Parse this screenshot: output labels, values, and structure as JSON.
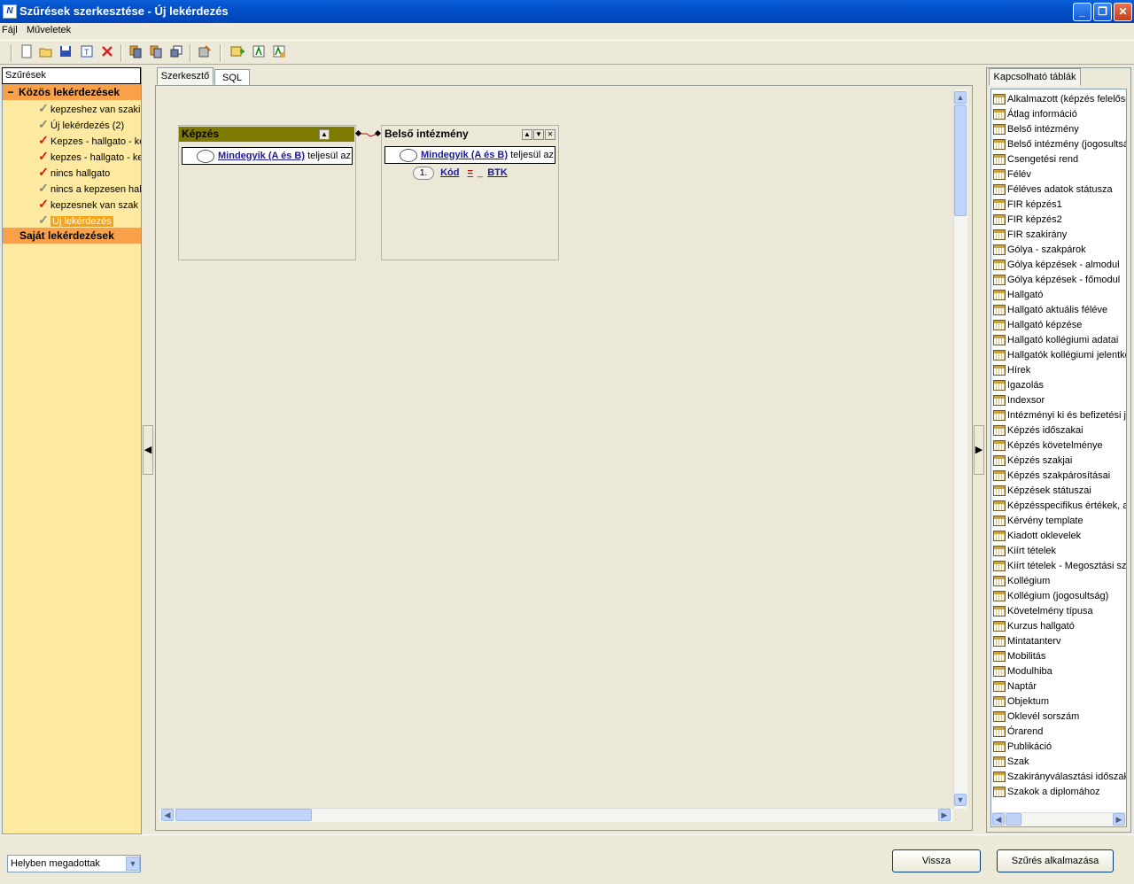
{
  "window": {
    "title": "Szűrések szerkesztése - Új lekérdezés",
    "app_icon": "N",
    "controls": {
      "minimize": "_",
      "maximize": "❐",
      "close": "✕"
    }
  },
  "menu": {
    "file": "Fájl",
    "operations": "Műveletek"
  },
  "toolbar": {
    "icons": [
      "new-icon",
      "open-icon",
      "save-icon",
      "rename-icon",
      "delete-icon",
      "copy-icon",
      "paste-icon",
      "export-icon",
      "settings-icon",
      "add-table-icon",
      "query-icon",
      "run-icon"
    ]
  },
  "left_panel": {
    "header": "Szűrések",
    "groups": [
      {
        "label": "Közös lekérdezések",
        "expander": "−",
        "items": [
          {
            "label": "kepzeshez van szakir",
            "check": "gray"
          },
          {
            "label": "Új lekérdezés (2)",
            "check": "gray"
          },
          {
            "label": "Kepzes - hallgato - ke",
            "check": "red"
          },
          {
            "label": "kepzes - hallgato - ke",
            "check": "red"
          },
          {
            "label": "nincs hallgato",
            "check": "red"
          },
          {
            "label": "nincs a kepzesen hal",
            "check": "gray"
          },
          {
            "label": "kepzesnek van szak",
            "check": "red"
          },
          {
            "label": "Új lekérdezés",
            "check": "gray",
            "selected": true
          }
        ]
      },
      {
        "label": "Saját lekérdezések"
      }
    ]
  },
  "tabs": {
    "editor": "Szerkesztő",
    "sql": "SQL"
  },
  "canvas": {
    "table1": {
      "title": "Képzés",
      "cond_link": "Mindegyik (A és B)",
      "cond_text": "teljesül az"
    },
    "table2": {
      "title": "Belső intézmény",
      "cond_link": "Mindegyik (A és B)",
      "cond_text": "teljesül az",
      "row_num": "1.",
      "field": "Kód",
      "op": "=",
      "value": "BTK"
    }
  },
  "right_panel": {
    "tab": "Kapcsolható táblák",
    "items": [
      "Alkalmazott (képzés felelőse)",
      "Átlag információ",
      "Belső intézmény",
      "Belső intézmény (jogosultság)",
      "Csengetési rend",
      "Félév",
      "Féléves adatok státusza",
      "FIR képzés1",
      "FIR képzés2",
      "FIR szakirány",
      "Gólya - szakpárok",
      "Gólya képzések - almodul",
      "Gólya képzések - főmodul",
      "Hallgató",
      "Hallgató aktuális féléve",
      "Hallgató képzése",
      "Hallgató kollégiumi adatai",
      "Hallgatók kollégiumi jelentkezései",
      "Hírek",
      "Igazolás",
      "Indexsor",
      "Intézményi ki és befizetési jogcímek",
      "Képzés időszakai",
      "Képzés követelménye",
      "Képzés szakjai",
      "Képzés szakpárosításai",
      "Képzések státuszai",
      "Képzésspecifikus értékek, alapadatok",
      "Kérvény template",
      "Kiadott oklevelek",
      "Kiírt tételek",
      "Kiírt tételek - Megosztási szabályok",
      "Kollégium",
      "Kollégium (jogosultság)",
      "Követelmény típusa",
      "Kurzus hallgató",
      "Mintatanterv",
      "Mobilitás",
      "Modulhiba",
      "Naptár",
      "Objektum",
      "Oklevél sorszám",
      "Órarend",
      "Publikáció",
      "Szak",
      "Szakirányválasztási időszakok",
      "Szakok a diplomához"
    ]
  },
  "bottom": {
    "select_value": "Helyben megadottak",
    "back": "Vissza",
    "apply": "Szűrés alkalmazása"
  }
}
